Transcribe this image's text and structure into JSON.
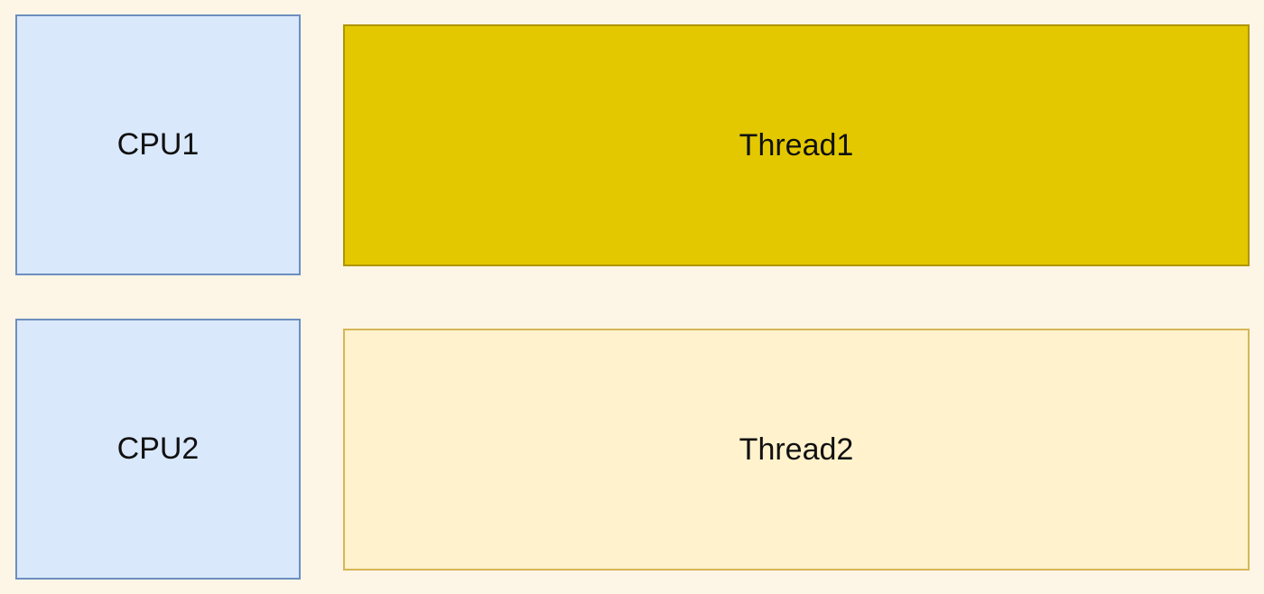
{
  "cpus": [
    {
      "label": "CPU1",
      "fill": "#dae8fc",
      "stroke": "#6c8ebf"
    },
    {
      "label": "CPU2",
      "fill": "#dae8fc",
      "stroke": "#6c8ebf"
    }
  ],
  "threads": [
    {
      "label": "Thread1",
      "fill": "#e3c800",
      "stroke": "#b09500"
    },
    {
      "label": "Thread2",
      "fill": "#fff2cc",
      "stroke": "#d6b656"
    }
  ],
  "background": "#fdf5e6"
}
